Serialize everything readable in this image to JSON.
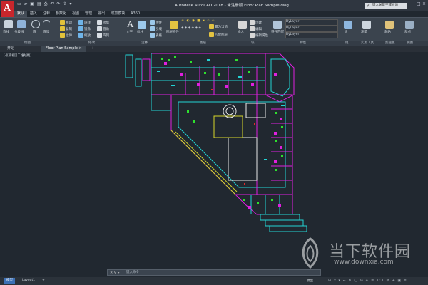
{
  "app": {
    "title": "Autodesk AutoCAD 2018 - 未注册版    Floor Plan Sample.dwg",
    "logo_letter": "A",
    "search_placeholder": "键入关键字或短语"
  },
  "menu_tabs": [
    "默认",
    "插入",
    "注释",
    "参数化",
    "视图",
    "管理",
    "输出",
    "附加模块",
    "A360"
  ],
  "ribbon": {
    "tools": {
      "line": "直线",
      "polyline": "多段线",
      "circle": "圆",
      "arc": "圆弧",
      "move": "移动",
      "rotate": "旋转",
      "trim": "修剪",
      "copy": "复制",
      "mirror": "镜像",
      "fillet": "圆角",
      "stretch": "拉伸",
      "scale": "缩放",
      "array": "阵列",
      "text": "文字",
      "dimension": "标注",
      "linear": "线性",
      "leader": "引线",
      "table": "表格",
      "layer_properties": "图层特性",
      "match_layer": "匹配图层",
      "set_current": "置为当前",
      "insert": "插入",
      "create": "创建",
      "edit": "编辑",
      "edit_attributes": "编辑属性",
      "match_properties": "特性匹配",
      "group": "组",
      "measure": "测量",
      "paste": "粘贴",
      "base": "基点"
    },
    "layer_value": "0",
    "bylayer": "ByLayer",
    "panels": {
      "draw": "绘图",
      "modify": "修改",
      "annotation": "注释",
      "layers": "图层",
      "block": "块",
      "properties": "特性",
      "groups": "组",
      "utilities": "实用工具",
      "clipboard": "剪贴板",
      "view": "视图"
    }
  },
  "doc_tabs": {
    "start": "开始",
    "current": "Floor Plan Sample"
  },
  "viewport": {
    "label": "[-][俯视][二维线框]"
  },
  "command": {
    "prompt": "键入命令"
  },
  "layout_tabs": [
    "模型",
    "Layout1"
  ],
  "status": {
    "model": "模型",
    "icons": "⊞ ∷ ▾ ⌐ ↻ ▢ ⊙ ✦ ≡ 1:1 ⚙ + ▣ ≡"
  },
  "watermark": {
    "text": "当下软件园",
    "url": "www.downxia.com"
  },
  "colors": {
    "magenta": "#e01fe0",
    "cyan": "#22d3d3",
    "green": "#2ee02e",
    "yellow": "#d6d62a",
    "red": "#e02a2a",
    "white": "#e8e8e8",
    "accent": "#c8262c"
  }
}
